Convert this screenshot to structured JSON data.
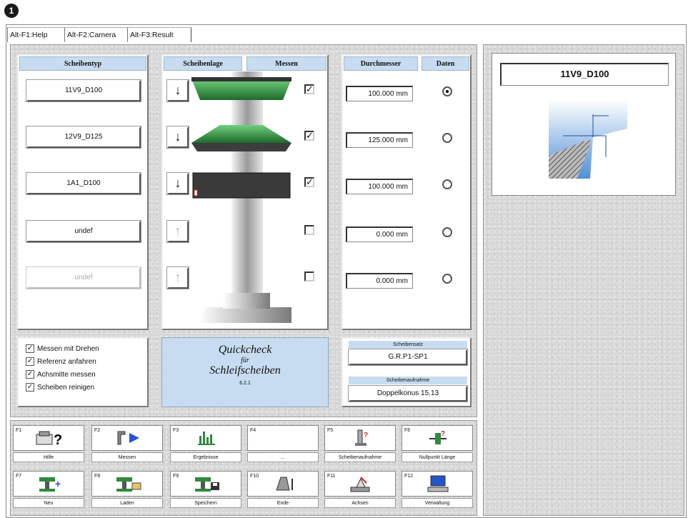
{
  "badge": "1",
  "tabs": [
    "Alt-F1:Help",
    "Alt-F2:Camera",
    "Alt-F3:Result"
  ],
  "headers": {
    "wheel_type": "Scheibentyp",
    "wheel_position": "Scheibenlage",
    "measure": "Messen",
    "diameter": "Durchmesser",
    "data": "Daten"
  },
  "wheels": [
    {
      "name": "11V9_D100",
      "diameter": "100.000 mm",
      "measure": true,
      "selected": true,
      "enabled": true,
      "arrow": "↓"
    },
    {
      "name": "12V9_D125",
      "diameter": "125.000 mm",
      "measure": true,
      "selected": false,
      "enabled": true,
      "arrow": "↓"
    },
    {
      "name": "1A1_D100",
      "diameter": "100.000 mm",
      "measure": true,
      "selected": false,
      "enabled": true,
      "arrow": "↓"
    },
    {
      "name": "undef",
      "diameter": "0.000 mm",
      "measure": false,
      "selected": false,
      "enabled": true,
      "arrow": "↑"
    },
    {
      "name": "undef",
      "diameter": "0.000 mm",
      "measure": false,
      "selected": false,
      "enabled": false,
      "arrow": "↑"
    }
  ],
  "options": [
    {
      "label": "Messen mit Drehen",
      "checked": true
    },
    {
      "label": "Referenz anfahren",
      "checked": true
    },
    {
      "label": "Achsmitte messen",
      "checked": true
    },
    {
      "label": "Scheiben reinigen",
      "checked": true
    }
  ],
  "quickcheck": {
    "line1": "Quickcheck",
    "line2": "für",
    "line3": "Schleifscheiben",
    "version": "6.2.1"
  },
  "wheel_set": {
    "label": "Scheibensatz",
    "value": "G.R.P1-SP1"
  },
  "wheel_mount": {
    "label": "Scheibenaufnahme",
    "value": "Doppelkonus 15.13"
  },
  "preview": {
    "title": "11V9_D100"
  },
  "fkeys": [
    {
      "key": "F1",
      "label": "Hilfe",
      "icon": "help-icon"
    },
    {
      "key": "F2",
      "label": "Messen",
      "icon": "measure-play-icon"
    },
    {
      "key": "F3",
      "label": "Ergebnisse",
      "icon": "results-chart-icon"
    },
    {
      "key": "F4",
      "label": "...",
      "icon": ""
    },
    {
      "key": "F5",
      "label": "Scheibenaufnahme",
      "icon": "wheel-mount-icon"
    },
    {
      "key": "F6",
      "label": "Nullpunkt Länge",
      "icon": "zero-point-icon"
    },
    {
      "key": "F7",
      "label": "Neu",
      "icon": "new-icon"
    },
    {
      "key": "F8",
      "label": "Laden",
      "icon": "load-icon"
    },
    {
      "key": "F9",
      "label": "Speichern",
      "icon": "save-icon"
    },
    {
      "key": "F10",
      "label": "Ende",
      "icon": "exit-icon"
    },
    {
      "key": "F11",
      "label": "Achsen",
      "icon": "axes-icon"
    },
    {
      "key": "F12",
      "label": "Verwaltung",
      "icon": "admin-computer-icon"
    }
  ],
  "colors": {
    "header_blue": "#c7dcf0",
    "wheel_green": "#2e8b3e",
    "wheel_dark": "#3a3a3a",
    "accent_blue": "#2255cc"
  }
}
